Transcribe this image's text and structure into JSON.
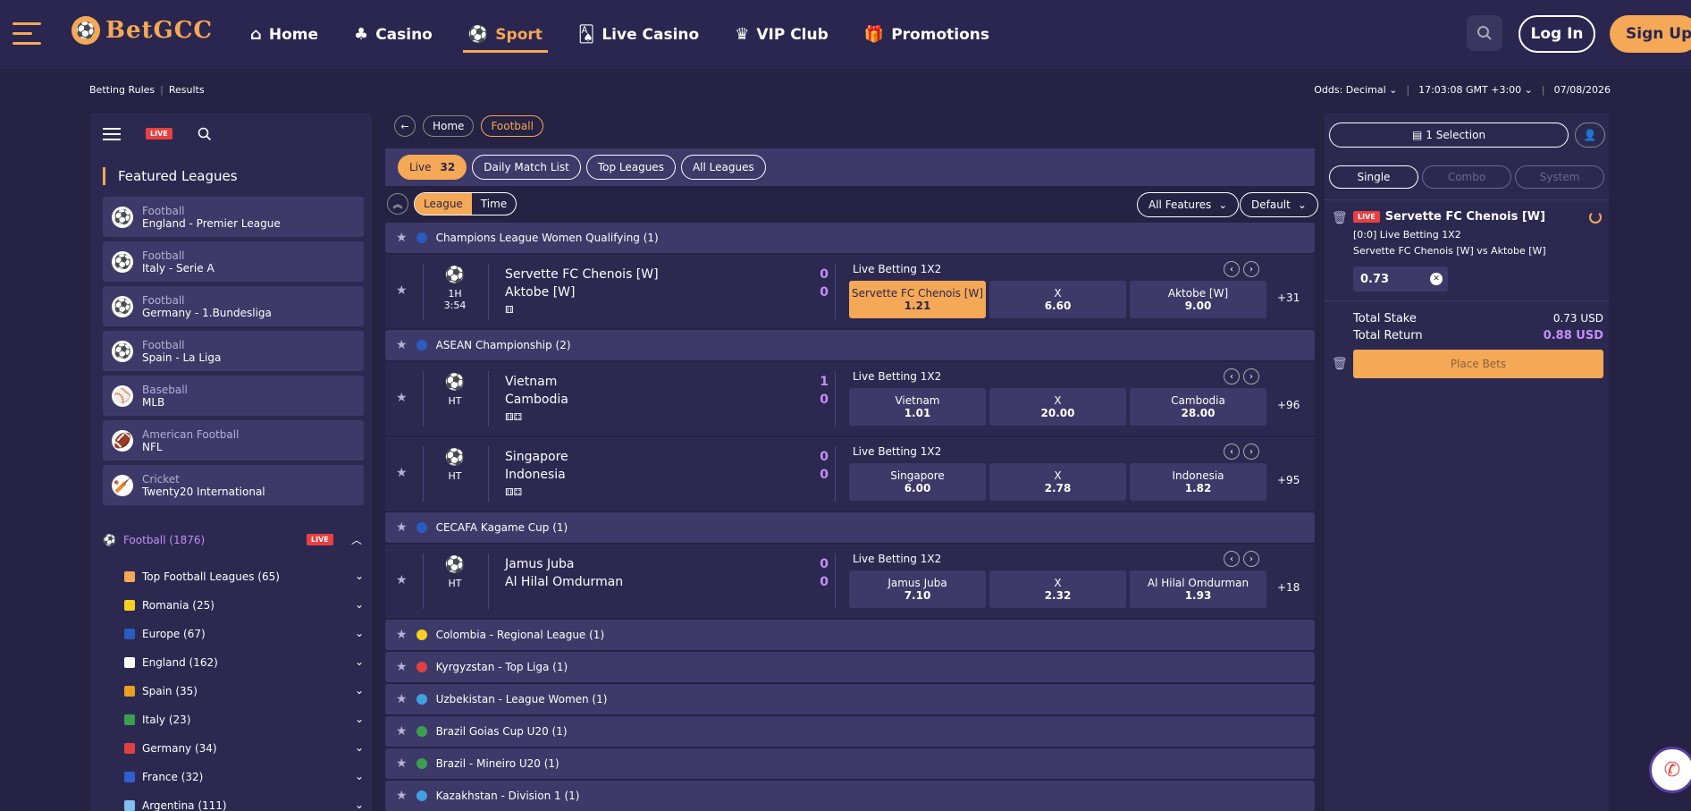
{
  "brand": {
    "name": "BetGCC",
    "accent": "#f5a855"
  },
  "nav": [
    {
      "label": "Home",
      "icon": "home-icon",
      "glyph": "⌂"
    },
    {
      "label": "Casino",
      "icon": "cherry-icon",
      "glyph": "♣"
    },
    {
      "label": "Sport",
      "icon": "football-icon",
      "glyph": "⚽",
      "active": true
    },
    {
      "label": "Live Casino",
      "icon": "cards-icon",
      "glyph": "🂡"
    },
    {
      "label": "VIP Club",
      "icon": "crown-icon",
      "glyph": "♛"
    },
    {
      "label": "Promotions",
      "icon": "gift-icon",
      "glyph": "🎁"
    }
  ],
  "auth": {
    "login": "Log In",
    "signup": "Sign Up"
  },
  "subbar": {
    "rules": "Betting Rules",
    "results": "Results",
    "odds": "Odds:  Decimal",
    "time": "17:03:08 GMT +3:00",
    "date": "07/08/2026"
  },
  "left": {
    "live": "LIVE",
    "featured_title": "Featured Leagues",
    "featured": [
      {
        "sport": "Football",
        "league": "England - Premier League",
        "glyph": "⚽"
      },
      {
        "sport": "Football",
        "league": "Italy - Serie A",
        "glyph": "⚽"
      },
      {
        "sport": "Football",
        "league": "Germany - 1.Bundesliga",
        "glyph": "⚽"
      },
      {
        "sport": "Football",
        "league": "Spain - La Liga",
        "glyph": "⚽"
      },
      {
        "sport": "Baseball",
        "league": "MLB",
        "glyph": "⚾"
      },
      {
        "sport": "American Football",
        "league": "NFL",
        "glyph": "🏈"
      },
      {
        "sport": "Cricket",
        "league": "Twenty20 International",
        "glyph": "🏏"
      }
    ],
    "category": {
      "name": "Football",
      "count": "(1876)"
    },
    "countries": [
      {
        "label": "Top Football Leagues (65)",
        "color": "#f5a855"
      },
      {
        "label": "Romania (25)",
        "color": "#f5d020"
      },
      {
        "label": "Europe (67)",
        "color": "#2a5cc0"
      },
      {
        "label": "England (162)",
        "color": "#ffffff"
      },
      {
        "label": "Spain (35)",
        "color": "#e8a020"
      },
      {
        "label": "Italy (23)",
        "color": "#3aa050"
      },
      {
        "label": "Germany (34)",
        "color": "#e04040"
      },
      {
        "label": "France (32)",
        "color": "#3060d0"
      },
      {
        "label": "Argentina (111)",
        "color": "#80c0f0"
      }
    ]
  },
  "center": {
    "crumbs": [
      "Home",
      "Football"
    ],
    "filters": {
      "live": "Live",
      "live_count": "32",
      "daily": "Daily Match List",
      "top": "Top Leagues",
      "all": "All Leagues"
    },
    "sort": {
      "league": "League",
      "time": "Time",
      "features": "All Features",
      "default": "Default"
    },
    "market_label": "Live Betting 1X2",
    "groups": [
      {
        "name": "Champions League Women Qualifying (1)",
        "color": "#2a5cc0",
        "matches": [
          {
            "period": "1H",
            "clock": "3:54",
            "home": "Servette FC Chenois [W]",
            "away": "Aktobe [W]",
            "hs": "0",
            "as": "0",
            "icons": "⚅",
            "odds": [
              [
                "Servette FC Chenois [W]",
                "1.21",
                true
              ],
              [
                "X",
                "6.60",
                false
              ],
              [
                "Aktobe [W]",
                "9.00",
                false
              ]
            ],
            "more": "+31"
          }
        ]
      },
      {
        "name": "ASEAN Championship (2)",
        "color": "#2a5cc0",
        "matches": [
          {
            "period": "HT",
            "clock": "",
            "home": "Vietnam",
            "away": "Cambodia",
            "hs": "1",
            "as": "0",
            "icons": "⚅⚃",
            "odds": [
              [
                "Vietnam",
                "1.01",
                false
              ],
              [
                "X",
                "20.00",
                false
              ],
              [
                "Cambodia",
                "28.00",
                false
              ]
            ],
            "more": "+96"
          },
          {
            "period": "HT",
            "clock": "",
            "home": "Singapore",
            "away": "Indonesia",
            "hs": "0",
            "as": "0",
            "icons": "⚅⚃",
            "odds": [
              [
                "Singapore",
                "6.00",
                false
              ],
              [
                "X",
                "2.78",
                false
              ],
              [
                "Indonesia",
                "1.82",
                false
              ]
            ],
            "more": "+95"
          }
        ]
      },
      {
        "name": "CECAFA Kagame Cup (1)",
        "color": "#2a5cc0",
        "matches": [
          {
            "period": "HT",
            "clock": "",
            "home": "Jamus Juba",
            "away": "Al Hilal Omdurman",
            "hs": "0",
            "as": "0",
            "icons": "",
            "odds": [
              [
                "Jamus Juba",
                "7.10",
                false
              ],
              [
                "X",
                "2.32",
                false
              ],
              [
                "Al Hilal Omdurman",
                "1.93",
                false
              ]
            ],
            "more": "+18"
          }
        ]
      },
      {
        "name": "Colombia - Regional League (1)",
        "color": "#f5d020",
        "matches": []
      },
      {
        "name": "Kyrgyzstan - Top Liga (1)",
        "color": "#e04040",
        "matches": []
      },
      {
        "name": "Uzbekistan - League Women (1)",
        "color": "#40a0e0",
        "matches": []
      },
      {
        "name": "Brazil Goias Cup U20 (1)",
        "color": "#3aa050",
        "matches": []
      },
      {
        "name": "Brazil - Mineiro U20 (1)",
        "color": "#3aa050",
        "matches": []
      },
      {
        "name": "Kazakhstan - Division 1 (1)",
        "color": "#40a0e0",
        "matches": []
      }
    ]
  },
  "slip": {
    "selection": "1 Selection",
    "tabs": [
      "Single",
      "Combo",
      "System"
    ],
    "live": "LIVE",
    "title": "Servette FC Chenois [W]",
    "line1": "[0:0] Live Betting 1X2",
    "line2": "Servette FC Chenois [W] vs Aktobe [W]",
    "stake": "0.73",
    "total_stake_label": "Total Stake",
    "total_stake": "0.73 USD",
    "total_return_label": "Total Return",
    "total_return": "0.88 USD",
    "place": "Place Bets"
  }
}
